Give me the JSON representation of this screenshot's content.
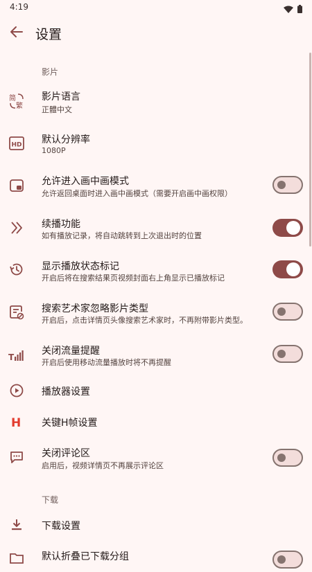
{
  "status_bar": {
    "time": "4:19",
    "wifi_icon": "wifi-icon",
    "battery_icon": "battery-icon"
  },
  "app_bar": {
    "title": "设置",
    "back_icon": "arrow-back-icon"
  },
  "colors": {
    "accent": "#8e4a48",
    "background": "#fff6f5",
    "switch_off_track": "#f3dddb",
    "switch_off_outline": "#85736f"
  },
  "sections": [
    {
      "header": "影片"
    },
    {
      "header": "下载"
    }
  ],
  "items": [
    {
      "icon": "simplified-traditional-icon",
      "title": "影片语言",
      "subtitle": "正體中文"
    },
    {
      "icon": "hd-icon",
      "title": "默认分辨率",
      "subtitle": "1080P"
    },
    {
      "icon": "picture-in-picture-icon",
      "title": "允许进入画中画模式",
      "subtitle": "允许返回桌面时进入画中画模式（需要开启画中画权限）",
      "switch": "off"
    },
    {
      "icon": "double-chevron-right-icon",
      "title": "续播功能",
      "subtitle": "如有播放记录，将自动跳转到上次退出时的位置",
      "switch": "on"
    },
    {
      "icon": "history-icon",
      "title": "显示播放状态标记",
      "subtitle": "开启后将在搜索结果页视频封面右上角显示已播放标记",
      "switch": "on"
    },
    {
      "icon": "document-block-icon",
      "title": "搜索艺术家忽略影片类型",
      "subtitle": "开启后，点击详情页头像搜索艺术家时，不再附带影片类型。",
      "switch": "off"
    },
    {
      "icon": "signal-bars-icon",
      "title": "关闭流量提醒",
      "subtitle": "开启后使用移动流量播放时将不再提醒",
      "switch": "off"
    },
    {
      "icon": "play-circle-icon",
      "title": "播放器设置"
    },
    {
      "icon": "h-letter-icon",
      "title": "关键H帧设置"
    },
    {
      "icon": "comment-icon",
      "title": "关闭评论区",
      "subtitle": "启用后，视频详情页不再展示评论区",
      "switch": "off"
    },
    {
      "icon": "download-icon",
      "title": "下载设置"
    },
    {
      "icon": "folder-icon",
      "title": "默认折叠已下载分组",
      "switch": "off"
    }
  ]
}
